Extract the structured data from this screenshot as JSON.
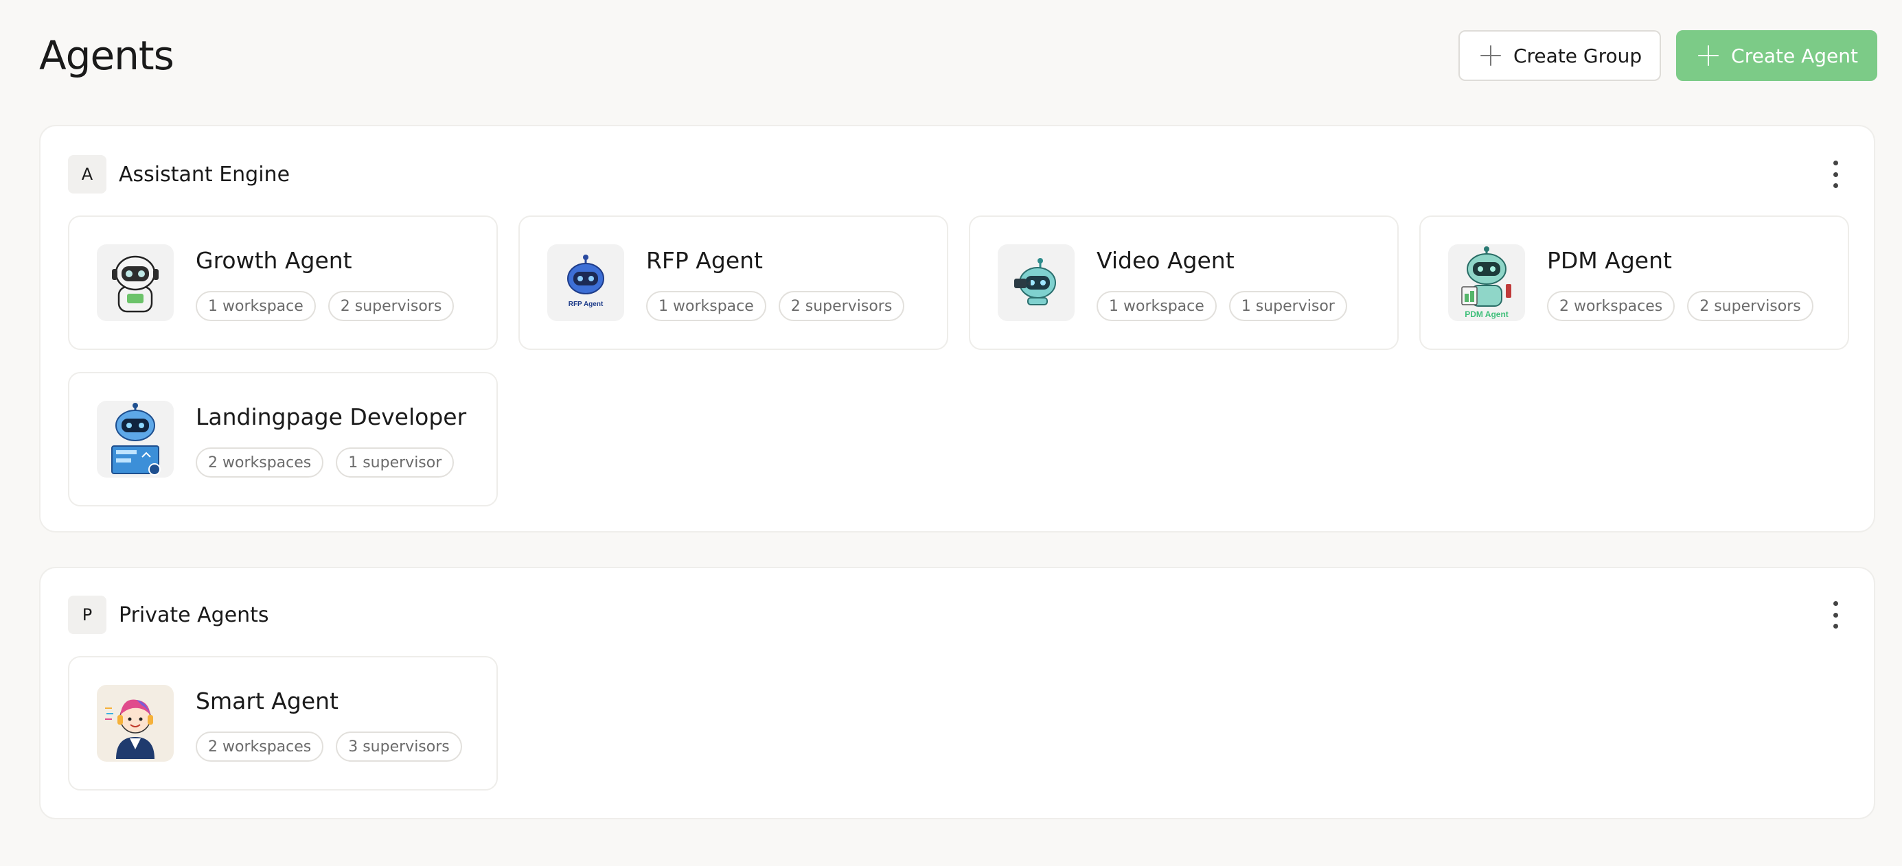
{
  "page": {
    "title": "Agents"
  },
  "actions": {
    "create_group": "Create Group",
    "create_agent": "Create Agent"
  },
  "colors": {
    "primary": "#7ccb87",
    "background": "#f9f8f6",
    "card_border": "#eeedea"
  },
  "groups": [
    {
      "badge": "A",
      "name": "Assistant Engine",
      "agents": [
        {
          "name": "Growth Agent",
          "icon": "robot-growth-icon",
          "chips": [
            "1 workspace",
            "2 supervisors"
          ]
        },
        {
          "name": "RFP Agent",
          "icon": "robot-rfp-icon",
          "icon_text": "RFP Agent",
          "chips": [
            "1 workspace",
            "2 supervisors"
          ]
        },
        {
          "name": "Video Agent",
          "icon": "robot-video-icon",
          "chips": [
            "1 workspace",
            "1 supervisor"
          ]
        },
        {
          "name": "PDM Agent",
          "icon": "robot-pdm-icon",
          "icon_text": "PDM Agent",
          "chips": [
            "2 workspaces",
            "2 supervisors"
          ]
        },
        {
          "name": "Landingpage Developer",
          "icon": "robot-developer-icon",
          "chips": [
            "2 workspaces",
            "1 supervisor"
          ]
        }
      ]
    },
    {
      "badge": "P",
      "name": "Private Agents",
      "agents": [
        {
          "name": "Smart Agent",
          "icon": "smart-agent-avatar-icon",
          "chips": [
            "2 workspaces",
            "3 supervisors"
          ]
        }
      ]
    }
  ]
}
